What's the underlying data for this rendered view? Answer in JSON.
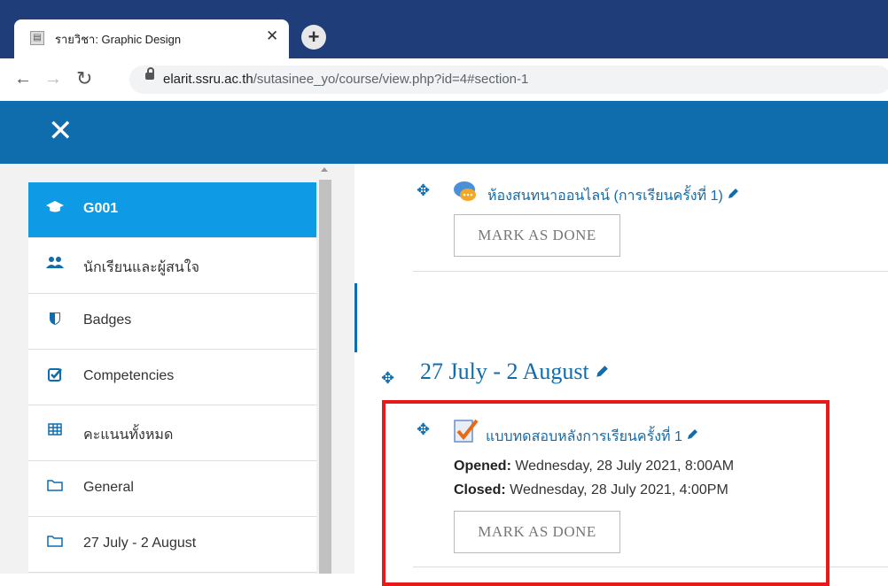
{
  "browser": {
    "tab_title": "รายวิชา: Graphic Design",
    "new_tab_label": "+",
    "url_host": "elarit.ssru.ac.th",
    "url_path": "/sutasinee_yo/course/view.php?id=4#section-1"
  },
  "header": {
    "close_label": "✕"
  },
  "drawer": {
    "items": [
      {
        "label": "G001",
        "icon": "graduation-cap-icon",
        "active": true
      },
      {
        "label": "นักเรียนและผู้สนใจ",
        "icon": "users-icon"
      },
      {
        "label": "Badges",
        "icon": "shield-icon"
      },
      {
        "label": "Competencies",
        "icon": "checkbox-icon"
      },
      {
        "label": "คะแนนทั้งหมด",
        "icon": "table-icon"
      },
      {
        "label": "General",
        "icon": "folder-icon"
      },
      {
        "label": "27 July - 2 August",
        "icon": "folder-icon"
      }
    ]
  },
  "main": {
    "chat_activity": {
      "name": "ห้องสนทนาออนไลน์ (การเรียนครั้งที่ 1)",
      "button": "MARK AS DONE"
    },
    "section": {
      "title": "27 July - 2 August"
    },
    "quiz_activity": {
      "name": "แบบทดสอบหลังการเรียนครั้งที่ 1",
      "opened_label": "Opened:",
      "opened_value": "Wednesday, 28 July 2021, 8:00AM",
      "closed_label": "Closed:",
      "closed_value": "Wednesday, 28 July 2021, 4:00PM",
      "button": "MARK AS DONE"
    }
  },
  "colors": {
    "brand": "#0f6cad",
    "active_nav": "#0f9ae6",
    "highlight": "#e61a1a"
  }
}
